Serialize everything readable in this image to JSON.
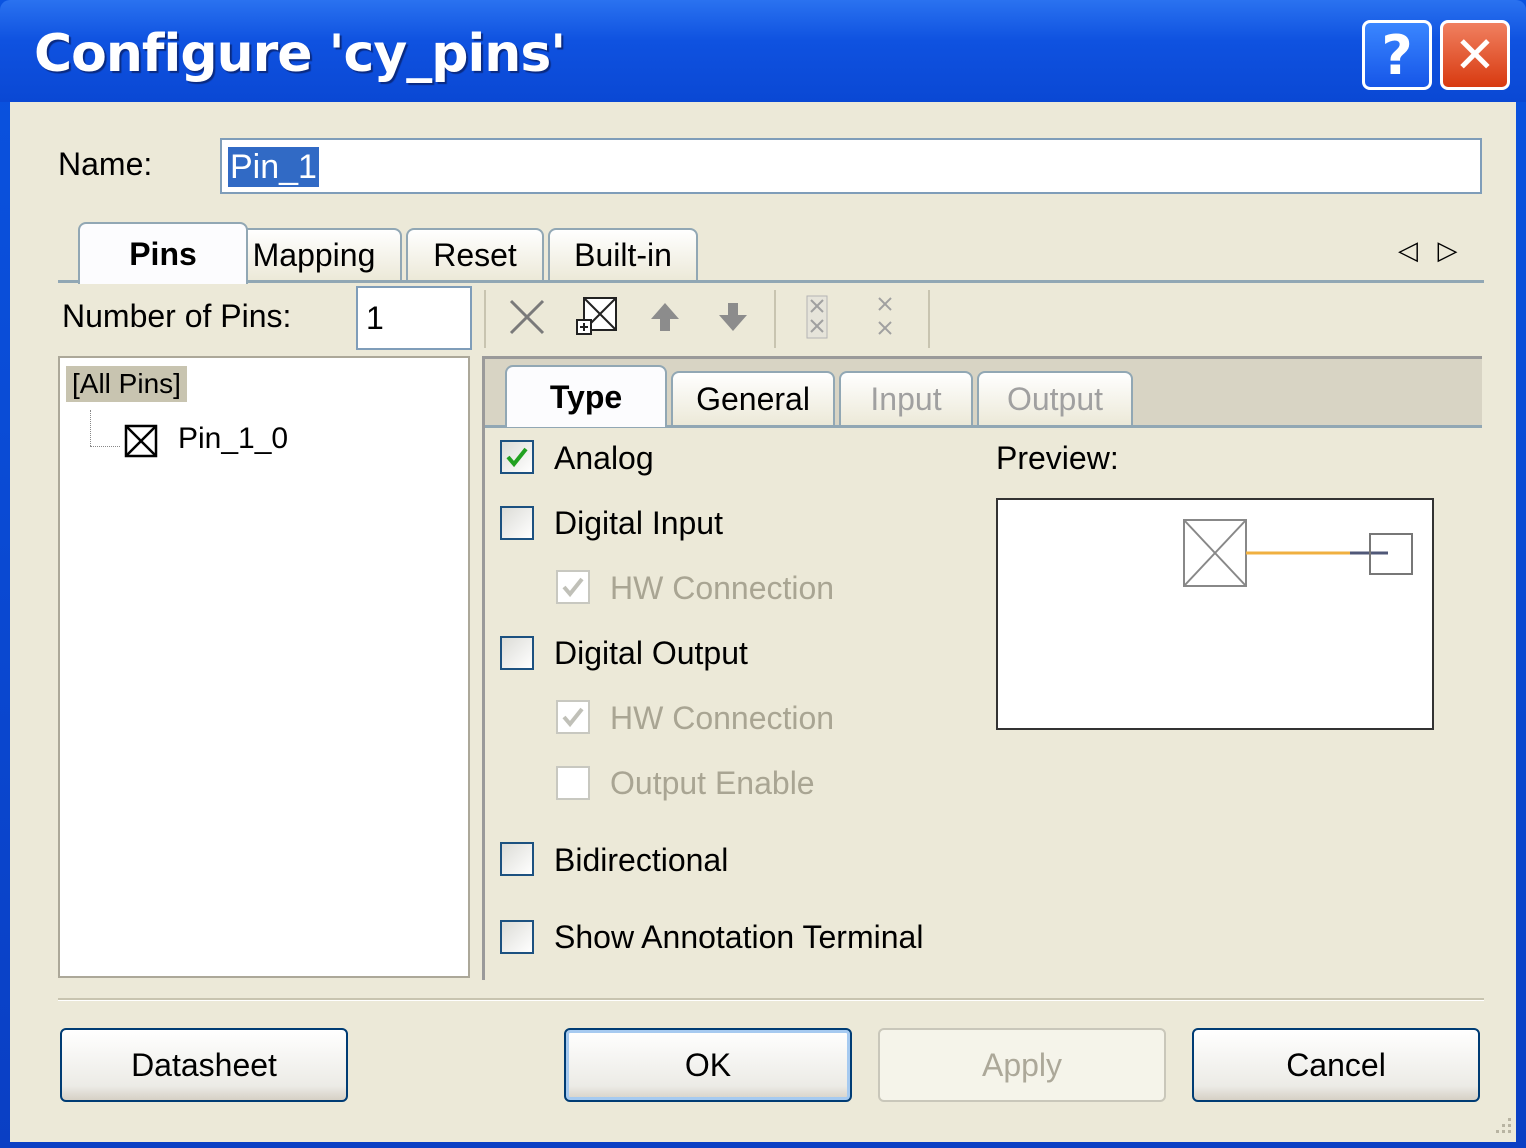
{
  "window": {
    "title": "Configure 'cy_pins'",
    "help_glyph": "?",
    "close_glyph": "✕"
  },
  "name": {
    "label": "Name:",
    "value": "Pin_1"
  },
  "tabs": [
    {
      "label": "Pins",
      "state": "active"
    },
    {
      "label": "Mapping",
      "state": "normal"
    },
    {
      "label": "Reset",
      "state": "normal"
    },
    {
      "label": "Built-in",
      "state": "normal"
    }
  ],
  "tab_scroll": {
    "left": "◁",
    "right": "▷"
  },
  "number_of_pins": {
    "label": "Number of Pins:",
    "value": "1"
  },
  "toolbar": {
    "icons": [
      "delete-icon",
      "add-pin-icon",
      "move-up-icon",
      "move-down-icon",
      "split-icon",
      "merge-icon"
    ]
  },
  "tree": {
    "root": "[All Pins]",
    "items": [
      "Pin_1_0"
    ]
  },
  "subtabs": [
    {
      "label": "Type",
      "state": "active"
    },
    {
      "label": "General",
      "state": "normal"
    },
    {
      "label": "Input",
      "state": "disabled"
    },
    {
      "label": "Output",
      "state": "disabled"
    }
  ],
  "type_options": {
    "analog": {
      "label": "Analog",
      "checked": true
    },
    "digital_input": {
      "label": "Digital Input",
      "checked": false
    },
    "digital_input_hw": {
      "label": "HW Connection",
      "checked": true,
      "disabled": true
    },
    "digital_output": {
      "label": "Digital Output",
      "checked": false
    },
    "digital_output_hw": {
      "label": "HW Connection",
      "checked": true,
      "disabled": true
    },
    "output_enable": {
      "label": "Output Enable",
      "checked": false,
      "disabled": true
    },
    "bidirectional": {
      "label": "Bidirectional",
      "checked": false
    },
    "annotation": {
      "label": "Show Annotation Terminal",
      "checked": false
    }
  },
  "preview": {
    "label": "Preview:"
  },
  "buttons": {
    "datasheet": "Datasheet",
    "ok": "OK",
    "apply": "Apply",
    "cancel": "Cancel"
  },
  "colors": {
    "titlebar": "#0a48d4",
    "client": "#ece9d8",
    "accent_check": "#21a121",
    "preview_wire": "#f0b040"
  }
}
